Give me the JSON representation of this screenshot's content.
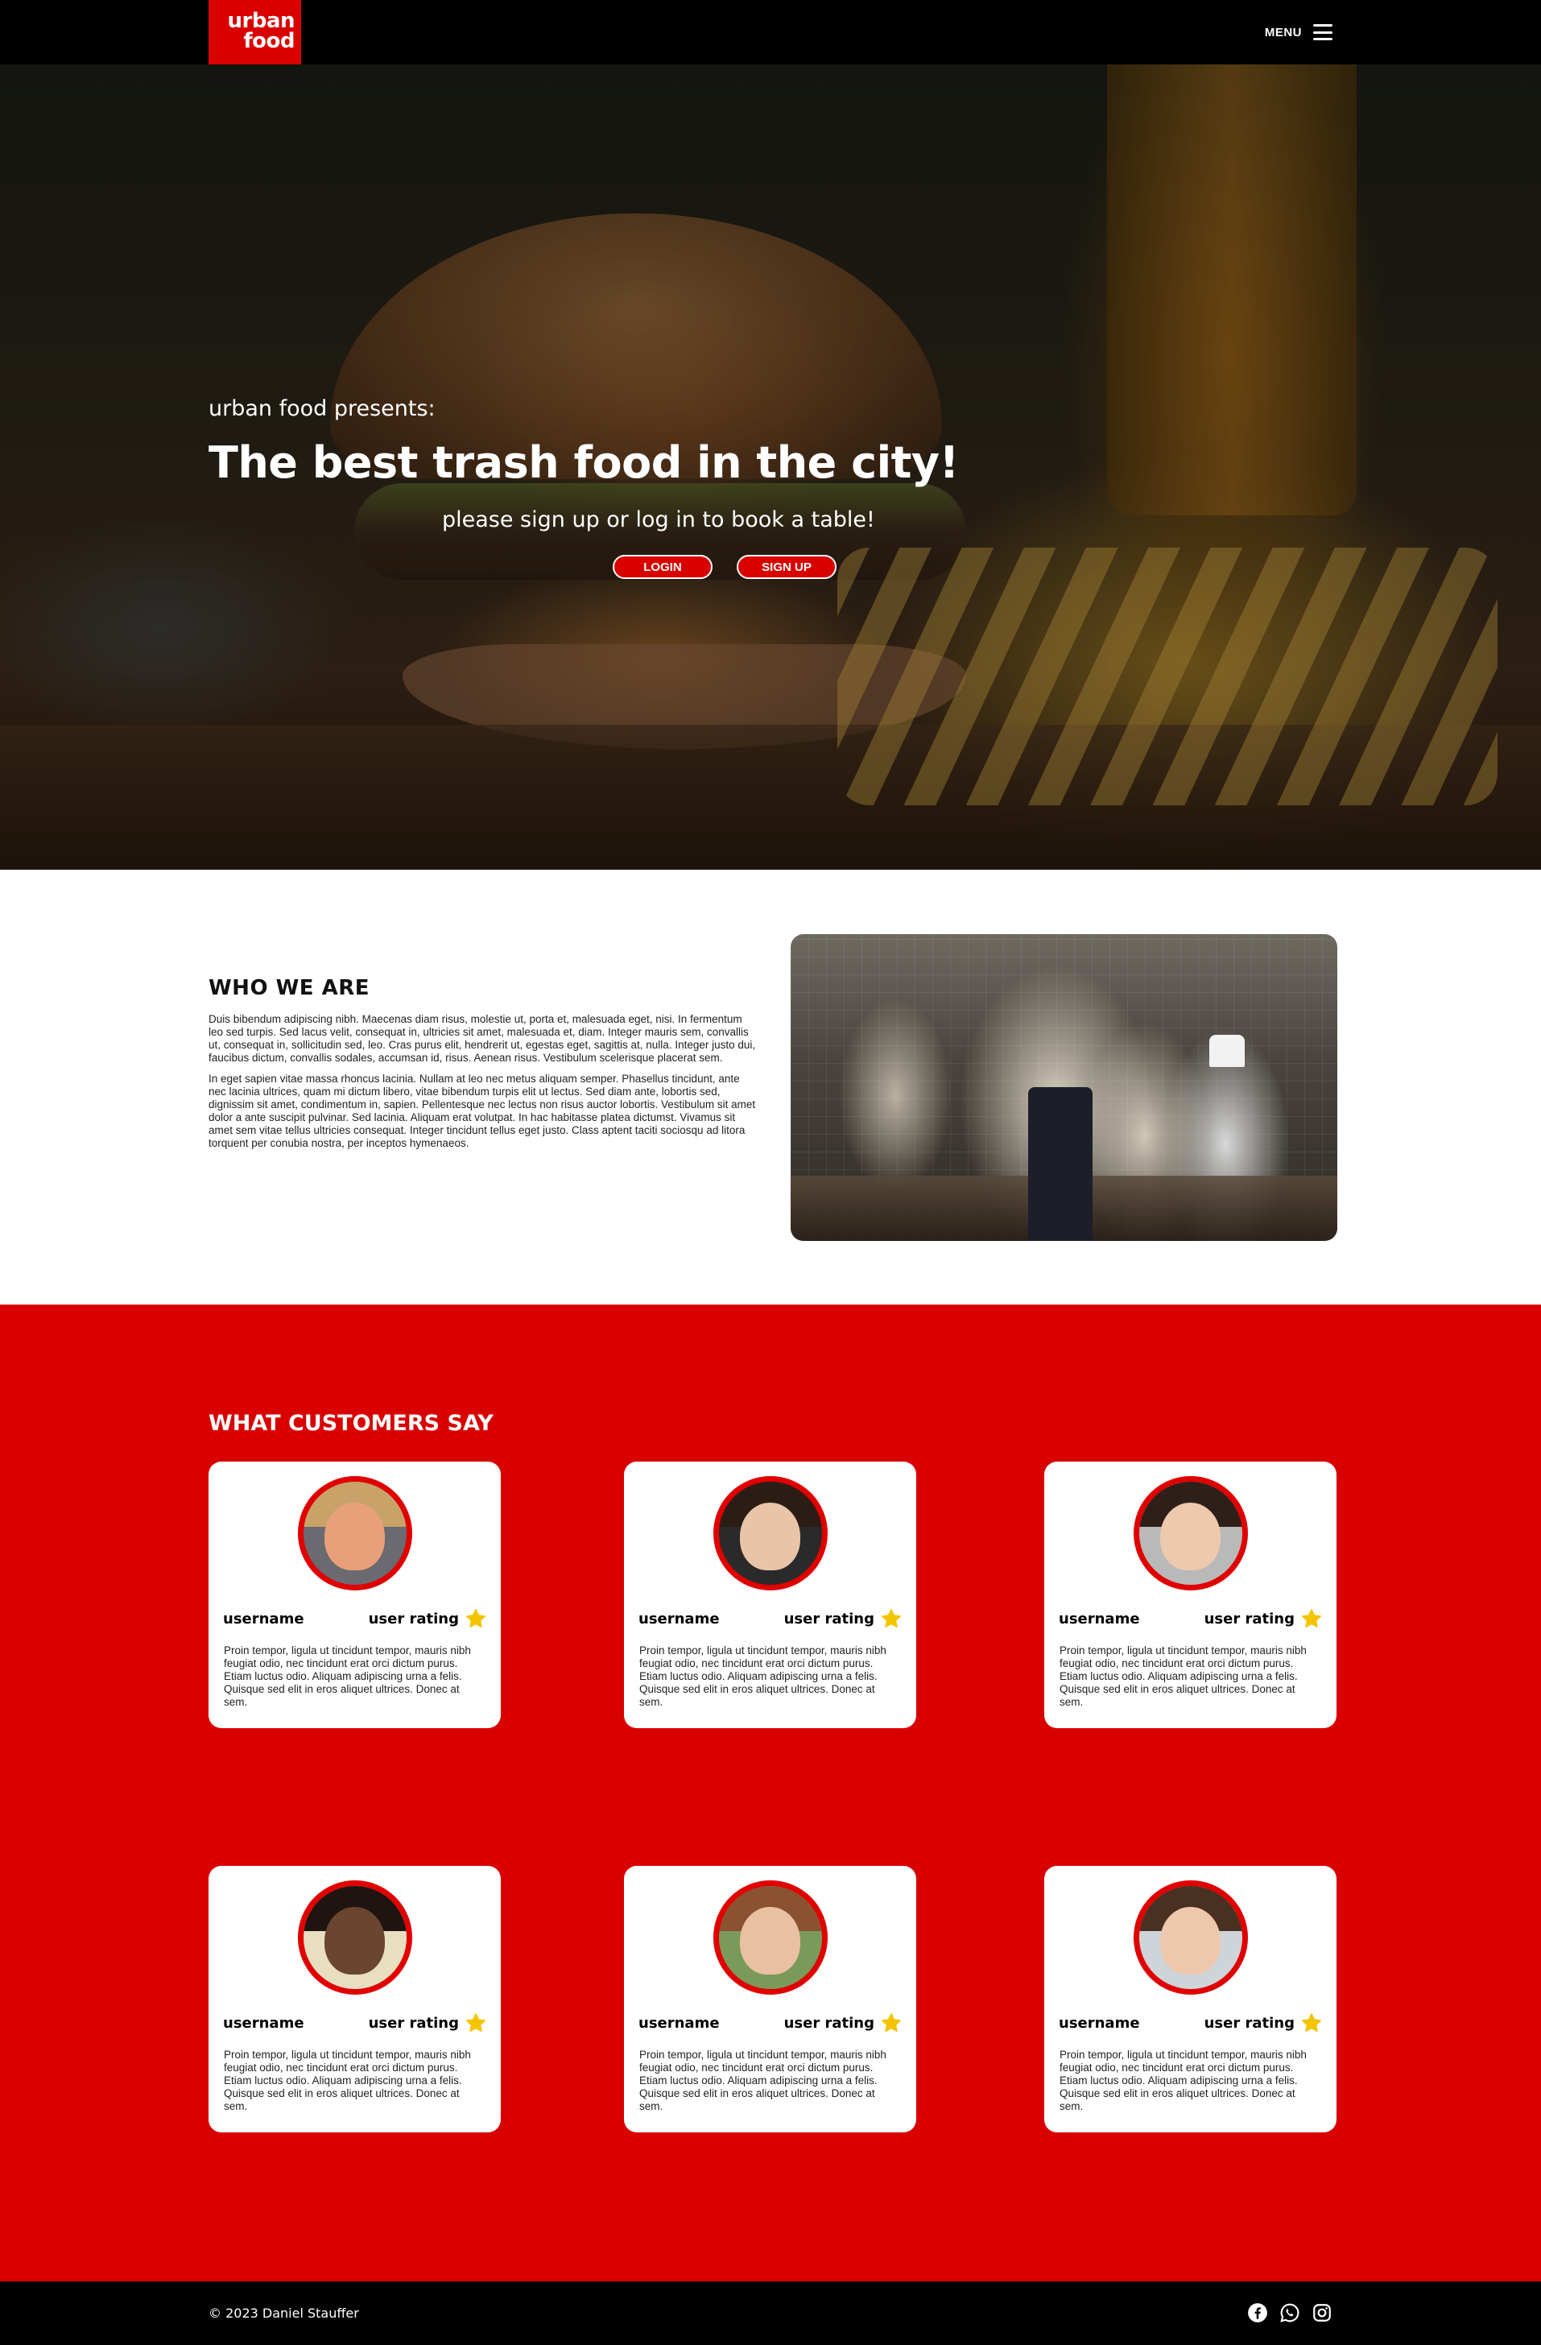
{
  "header": {
    "logo_line1": "urban",
    "logo_line2": "food",
    "menu_label": "MENU"
  },
  "hero": {
    "subtitle": "urban food presents:",
    "title": "The best trash food in the city!",
    "cta_text": "please sign up or log in to book a table!",
    "login_label": "LOGIN",
    "signup_label": "SIGN UP"
  },
  "who": {
    "title": "WHO WE ARE",
    "paragraph1": "Duis bibendum adipiscing nibh. Maecenas diam risus, molestie ut, porta et, malesuada eget, nisi. In fermentum leo sed turpis. Sed lacus velit, consequat in, ultricies sit amet, malesuada et, diam. Integer mauris sem, convallis ut, consequat in, sollicitudin sed, leo. Cras purus elit, hendrerit ut, egestas eget, sagittis at, nulla. Integer justo dui, faucibus dictum, convallis sodales, accumsan id, risus. Aenean risus. Vestibulum scelerisque placerat sem.",
    "paragraph2": "In eget sapien vitae massa rhoncus lacinia. Nullam at leo nec metus aliquam semper. Phasellus tincidunt, ante nec lacinia ultrices, quam mi dictum libero, vitae bibendum turpis elit ut lectus. Sed diam ante, lobortis sed, dignissim sit amet, condimentum in, sapien. Pellentesque nec lectus non risus auctor lobortis. Vestibulum sit amet dolor a ante suscipit pulvinar. Sed lacinia. Aliquam erat volutpat. In hac habitasse platea dictumst. Vivamus sit amet sem vitae tellus ultricies consequat. Integer tincidunt tellus eget justo. Class aptent taciti sociosqu ad litora torquent per conubia nostra, per inceptos hymenaeos."
  },
  "customers": {
    "title": "WHAT CUSTOMERS SAY",
    "star_color": "#f5c400",
    "accent_color": "#d90000",
    "reviews": [
      {
        "username": "username",
        "rating_label": "user rating",
        "text": "Proin tempor, ligula ut tincidunt tempor, mauris nibh feugiat odio, nec tincidunt erat orci dictum purus. Etiam luctus odio. Aliquam adipiscing urna a felis. Quisque sed elit in eros aliquet ultrices. Donec at sem."
      },
      {
        "username": "username",
        "rating_label": "user rating",
        "text": "Proin tempor, ligula ut tincidunt tempor, mauris nibh feugiat odio, nec tincidunt erat orci dictum purus. Etiam luctus odio. Aliquam adipiscing urna a felis. Quisque sed elit in eros aliquet ultrices. Donec at sem."
      },
      {
        "username": "username",
        "rating_label": "user rating",
        "text": "Proin tempor, ligula ut tincidunt tempor, mauris nibh feugiat odio, nec tincidunt erat orci dictum purus. Etiam luctus odio. Aliquam adipiscing urna a felis. Quisque sed elit in eros aliquet ultrices. Donec at sem."
      },
      {
        "username": "username",
        "rating_label": "user rating",
        "text": "Proin tempor, ligula ut tincidunt tempor, mauris nibh feugiat odio, nec tincidunt erat orci dictum purus. Etiam luctus odio. Aliquam adipiscing urna a felis. Quisque sed elit in eros aliquet ultrices. Donec at sem."
      },
      {
        "username": "username",
        "rating_label": "user rating",
        "text": "Proin tempor, ligula ut tincidunt tempor, mauris nibh feugiat odio, nec tincidunt erat orci dictum purus. Etiam luctus odio. Aliquam adipiscing urna a felis. Quisque sed elit in eros aliquet ultrices. Donec at sem."
      },
      {
        "username": "username",
        "rating_label": "user rating",
        "text": "Proin tempor, ligula ut tincidunt tempor, mauris nibh feugiat odio, nec tincidunt erat orci dictum purus. Etiam luctus odio. Aliquam adipiscing urna a felis. Quisque sed elit in eros aliquet ultrices. Donec at sem."
      }
    ]
  },
  "footer": {
    "copyright": "© 2023 Daniel Stauffer",
    "social_icons": [
      "facebook-icon",
      "whatsapp-icon",
      "instagram-icon"
    ]
  }
}
